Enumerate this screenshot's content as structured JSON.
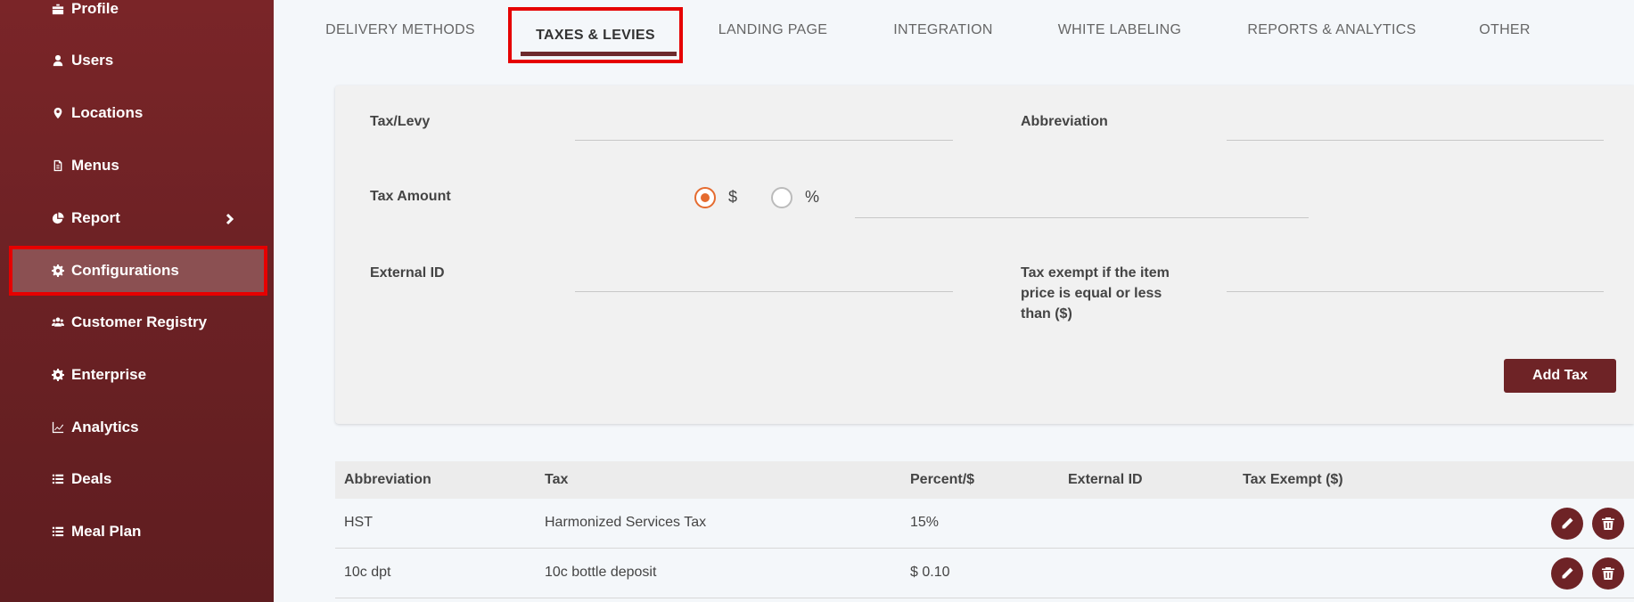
{
  "sidebar": {
    "items": [
      {
        "label": "Profile",
        "icon": "briefcase-icon"
      },
      {
        "label": "Users",
        "icon": "user-icon"
      },
      {
        "label": "Locations",
        "icon": "map-pin-icon"
      },
      {
        "label": "Menus",
        "icon": "document-icon"
      },
      {
        "label": "Report",
        "icon": "pie-chart-icon"
      },
      {
        "label": "Configurations",
        "icon": "gear-icon"
      },
      {
        "label": "Customer Registry",
        "icon": "users-icon"
      },
      {
        "label": "Enterprise",
        "icon": "gear-icon"
      },
      {
        "label": "Analytics",
        "icon": "line-chart-icon"
      },
      {
        "label": "Deals",
        "icon": "list-icon"
      },
      {
        "label": "Meal Plan",
        "icon": "list-icon"
      }
    ],
    "active": "Configurations",
    "bg_color": "#6b2124"
  },
  "tabs": [
    {
      "label": "DELIVERY METHODS"
    },
    {
      "label": "TAXES & LEVIES"
    },
    {
      "label": "LANDING PAGE"
    },
    {
      "label": "INTEGRATION"
    },
    {
      "label": "WHITE LABELING"
    },
    {
      "label": "REPORTS & ANALYTICS"
    },
    {
      "label": "OTHER"
    }
  ],
  "active_tab": "TAXES & LEVIES",
  "form": {
    "tax_levy_label": "Tax/Levy",
    "tax_levy_value": "",
    "abbreviation_label": "Abbreviation",
    "abbreviation_value": "",
    "tax_amount_label": "Tax Amount",
    "option_dollar": "$",
    "option_percent": "%",
    "selected_option": "$",
    "tax_amount_value": "",
    "external_id_label": "External ID",
    "external_id_value": "",
    "exempt_label_line1": "Tax exempt if the item",
    "exempt_label_line2": "price is equal or less",
    "exempt_label_line3": "than ($)",
    "exempt_value": "",
    "add_button": "Add Tax"
  },
  "table": {
    "headers": [
      "Abbreviation",
      "Tax",
      "Percent/$",
      "External ID",
      "Tax Exempt ($)"
    ],
    "rows": [
      {
        "abbreviation": "HST",
        "tax": "Harmonized Services Tax",
        "amount": "15%",
        "external_id": "",
        "exempt": ""
      },
      {
        "abbreviation": "10c dpt",
        "tax": "10c bottle deposit",
        "amount": "$ 0.10",
        "external_id": "",
        "exempt": ""
      }
    ]
  },
  "colors": {
    "accent": "#6e2326",
    "highlight": "#e60000",
    "radio": "#e56b2f"
  }
}
